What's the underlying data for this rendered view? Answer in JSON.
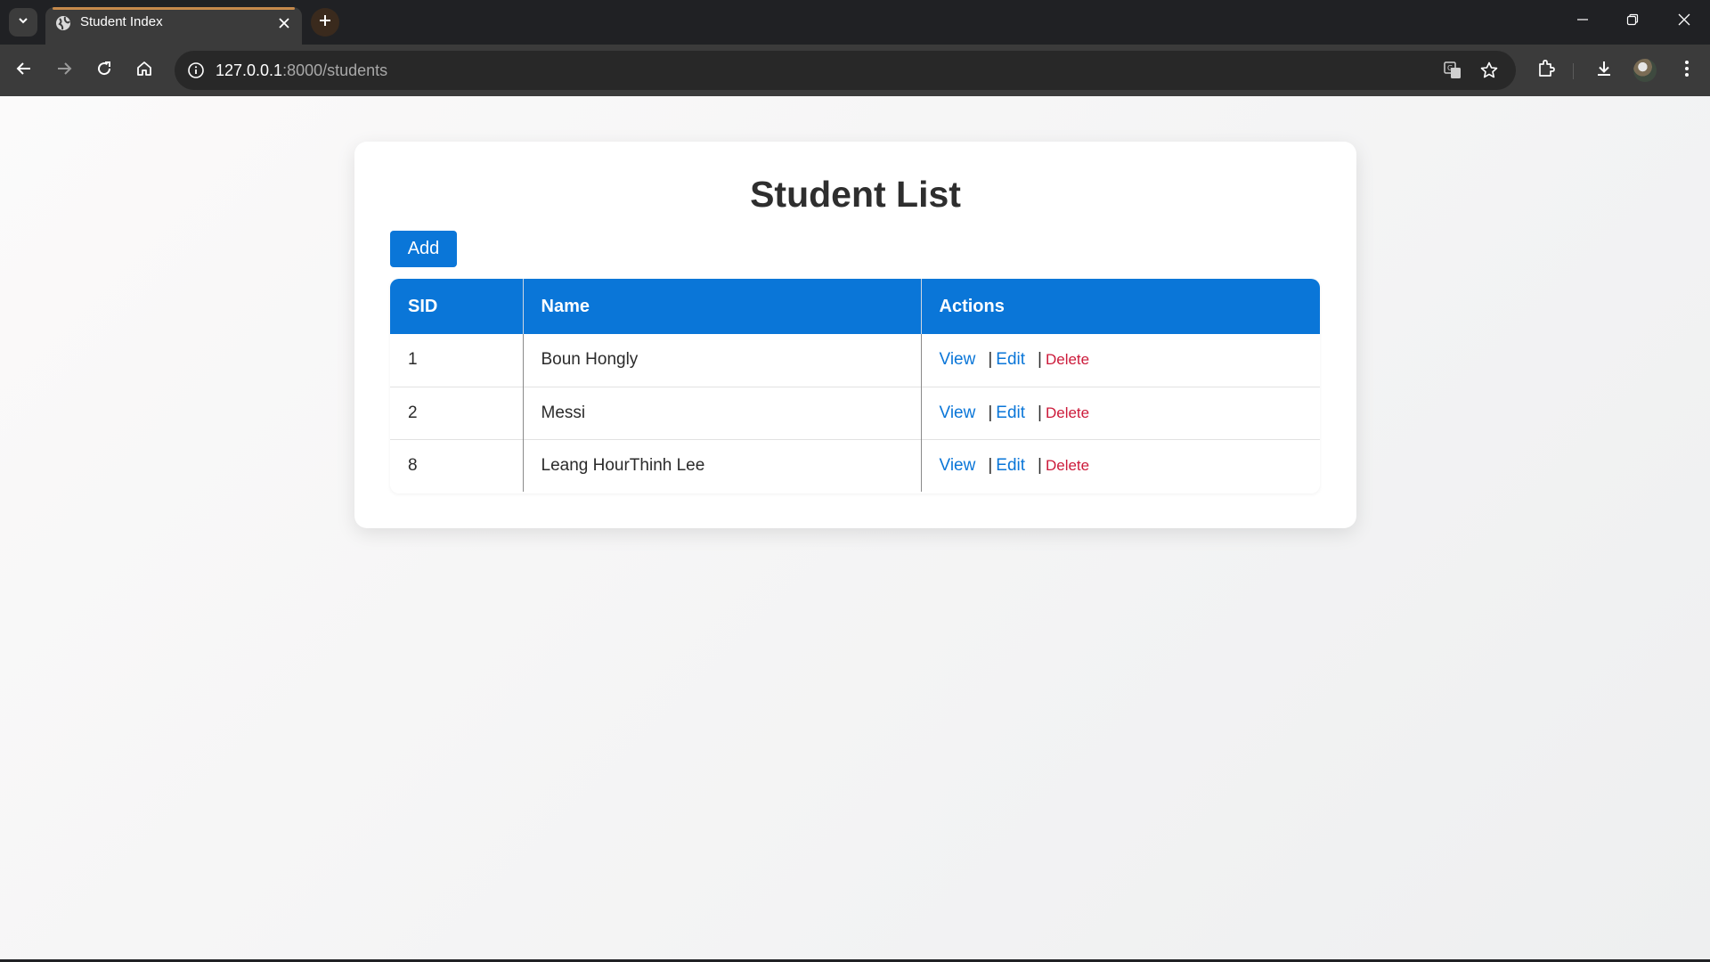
{
  "browser": {
    "tab": {
      "title": "Student Index"
    },
    "url": {
      "host": "127.0.0.1",
      "path": ":8000/students"
    },
    "colors": {
      "tab_accent": "#c5894b",
      "chrome_bg": "#202124",
      "toolbar_bg": "#3b3b3b"
    },
    "icons": [
      "tab-search-icon",
      "globe-favicon-icon",
      "close-icon",
      "plus-icon",
      "minimize-icon",
      "restore-icon",
      "window-close-icon",
      "back-icon",
      "forward-icon",
      "reload-icon",
      "home-icon",
      "site-info-icon",
      "translate-icon",
      "bookmark-star-icon",
      "extensions-icon",
      "download-icon",
      "avatar",
      "more-menu-icon"
    ]
  },
  "page": {
    "title": "Student List",
    "add_label": "Add",
    "table": {
      "headers": [
        "SID",
        "Name",
        "Actions"
      ],
      "rows": [
        {
          "sid": "1",
          "name": "Boun Hongly"
        },
        {
          "sid": "2",
          "name": "Messi"
        },
        {
          "sid": "8",
          "name": "Leang HourThinh Lee"
        }
      ],
      "actions": {
        "view": "View",
        "edit": "Edit",
        "delete": "Delete",
        "separator": "|"
      }
    },
    "colors": {
      "primary": "#0a76d8",
      "danger": "#cc1a3a",
      "title_text": "#2e2e2e"
    }
  }
}
